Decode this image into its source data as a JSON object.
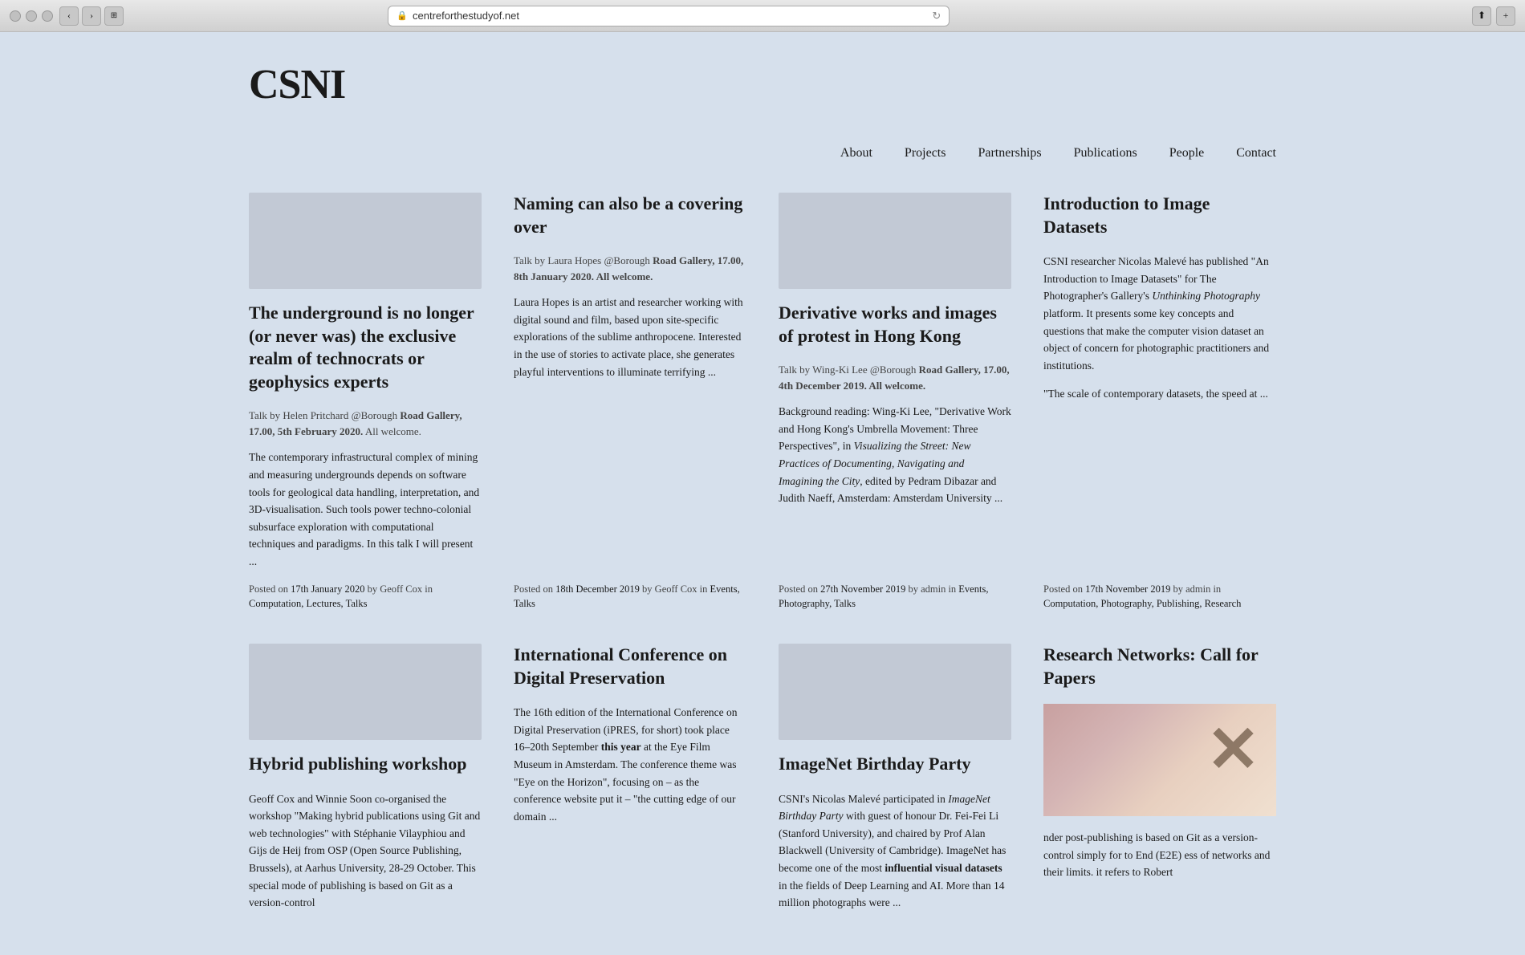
{
  "browser": {
    "url": "centreforthestudyof.net",
    "back_icon": "‹",
    "forward_icon": "›",
    "tab_icon": "⊞",
    "refresh_icon": "↻",
    "share_icon": "⬆",
    "plus_icon": "+"
  },
  "site": {
    "logo": "CSNI",
    "nav": {
      "items": [
        {
          "label": "About",
          "href": "#"
        },
        {
          "label": "Projects",
          "href": "#"
        },
        {
          "label": "Partnerships",
          "href": "#"
        },
        {
          "label": "Publications",
          "href": "#"
        },
        {
          "label": "People",
          "href": "#"
        },
        {
          "label": "Contact",
          "href": "#"
        }
      ]
    }
  },
  "posts_row1": [
    {
      "title": "The underground is no longer (or never was) the exclusive realm of technocrats or geophysics experts",
      "meta_talk": "Talk by Helen Pritchard @Borough",
      "meta_location": "Road Gallery, 17.00, 5th February 2020.",
      "meta_welcome": "All welcome.",
      "excerpt": "The contemporary infrastructural complex of mining and measuring undergrounds depends on software tools for geological data handling, interpretation, and 3D-visualisation. Such tools power techno-colonial subsurface exploration with computational techniques and paradigms. In this talk I will present ...",
      "posted_label": "Posted on",
      "posted_date": "17th January 2020",
      "posted_by": "by Geoff Cox in",
      "categories": "Computation, Lectures, Talks"
    },
    {
      "title": "Naming can also be a covering over",
      "meta_talk": "Talk by Laura Hopes @Borough",
      "meta_location": "Road Gallery, 17.00, 8th January 2020.",
      "meta_welcome": "All welcome.",
      "excerpt": "Laura Hopes is an artist and researcher working with digital sound and film, based upon site-specific explorations of the sublime anthropocene. Interested in the use of stories to activate place, she generates playful interventions to illuminate terrifying ...",
      "posted_label": "Posted on",
      "posted_date": "18th December 2019",
      "posted_by": "by Geoff Cox in",
      "categories": "Events, Talks"
    },
    {
      "title": "Derivative works and images of protest in Hong Kong",
      "meta_talk": "Talk by Wing-Ki Lee @Borough",
      "meta_location": "Road Gallery, 17.00, 4th December 2019.",
      "meta_welcome": "All welcome.",
      "excerpt": "Background reading: Wing-Ki Lee, \"Derivative Work and Hong Kong's Umbrella Movement: Three Perspectives\", in Visualizing the Street: New Practices of Documenting, Navigating and Imagining the City, edited by Pedram Dibazar and Judith Naeff, Amsterdam: Amsterdam University ...",
      "posted_label": "Posted on",
      "posted_date": "27th November 2019",
      "posted_by": "by admin in",
      "categories": "Events, Photography, Talks"
    },
    {
      "title": "Introduction to Image Datasets",
      "meta_intro": "CSNI researcher Nicolas Malevé",
      "meta_intro2": " has published \"An Introduction to Image Datasets\" for The Photographer's Gallery's ",
      "meta_italic": "Unthinking Photography",
      "meta_intro3": " platform. It presents some key concepts and questions that make the computer vision dataset an object of concern for photographic practitioners and institutions.",
      "quote": "\"The scale of contemporary datasets, the speed at ...\"",
      "posted_label": "Posted on",
      "posted_date": "17th November 2019",
      "posted_by": "by admin in",
      "categories": "Computation, Photography, Publishing, Research"
    }
  ],
  "posts_row2": [
    {
      "title": "Hybrid publishing workshop",
      "excerpt_main": "Geoff Cox and Winnie Soon co-organised the workshop \"Making hybrid publications using Git and web technologies\" with Stéphanie Vilayphiou and Gijs de Heij from OSP (Open Source Publishing, Brussels), at Aarhus University, 28-29 October. This special mode of publishing is based on Git as a version-control"
    },
    {
      "title": "International Conference on Digital Preservation",
      "excerpt_main": "The 16th edition of the International Conference on Digital Preservation (iPRES, for short) took place 16–20th September this year at the Eye Film Museum in Amsterdam. The conference theme was \"Eye on the Horizon\", focusing on – as the conference website put it – \"the cutting edge of our domain ..."
    },
    {
      "title": "ImageNet Birthday Party",
      "excerpt_main": "CSNI's Nicolas Malevé participated in ImageNet Birthday Party with guest of honour Dr. Fei-Fei Li (Stanford University), and chaired by Prof Alan Blackwell (University of Cambridge). ImageNet has become one of the most influential visual datasets in the fields of Deep Learning and AI. More than 14 million photographs were ..."
    },
    {
      "title": "Research Networks: Call for Papers",
      "excerpt_main": "nder post-publishing is based on Git as a version-control simply for\n\nto End (E2E\n\ness of networks and their limits. it refers to Robert"
    }
  ]
}
